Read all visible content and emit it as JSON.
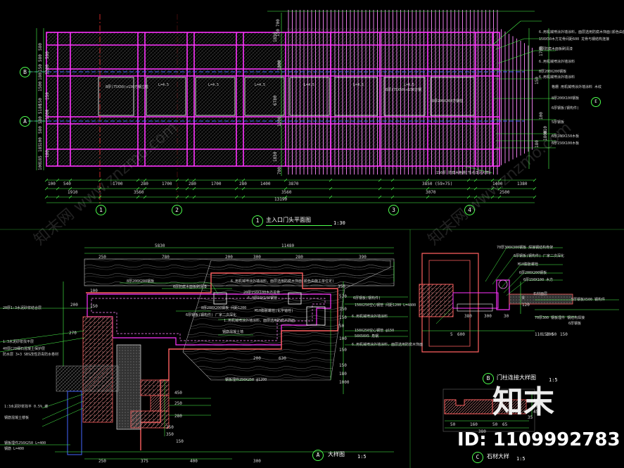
{
  "views": {
    "plan": {
      "marker": "1",
      "title": "主入口门头平面图",
      "scale": "1:30"
    },
    "detail_a": {
      "marker": "A",
      "title": "大样图",
      "scale": "1:5"
    },
    "detail_b": {
      "marker": "B",
      "title": "门柱连接大样图",
      "scale": "1:5"
    },
    "detail_c": {
      "marker": "C",
      "title": "石材大样",
      "scale": "1:5"
    }
  },
  "plan_axes": {
    "rows": [
      "B",
      "A"
    ],
    "cols": [
      "1",
      "2",
      "3",
      "4"
    ],
    "right_bubble": "E"
  },
  "plan_dims": {
    "left_vertical": [
      "580",
      "580",
      "150",
      "180",
      "1500",
      "150",
      "5180",
      "580",
      "580",
      "100",
      "185",
      "185",
      "100",
      "580",
      "1300",
      "150",
      "1500",
      "180"
    ],
    "top_horizontal": [
      "700",
      "150"
    ],
    "right_vertical": [
      "1850",
      "6780",
      "1850",
      "1800",
      "700",
      "1300",
      "1300",
      "1700",
      "1800",
      "150",
      "100",
      "810",
      "180"
    ],
    "bottom_row1": [
      "100",
      "540",
      "1700",
      "280",
      "1700",
      "280",
      "1700",
      "280",
      "1400",
      "3870",
      "3850 (59×75)",
      "1400",
      "1380"
    ],
    "bottom_row2": [
      "1910",
      "3560",
      "3560",
      "3070",
      "2500"
    ],
    "bottom_total": "13190"
  },
  "plan_notes": [
    "6.用机械喷涂外墙涂料，面层选用防腐木饰面(颜色由施工单位定)  盖板",
    "150X50木方龙骨间距600  龙骨与钢结构连接",
    "6厚防腐木面板刷清漆",
    "6.用机械喷涂外墙涂料",
    "8厚200X200钢板",
    "6.用机械喷涂外墙涂料",
    "格栅 用机械喷涂外墙涂料  木纹",
    "8厚200X100钢板",
    "6厚钢板(钢构件)",
    "5厚钢板",
    "6厚100X150木板",
    "6厚150X100木板"
  ],
  "plan_inner_labels": [
    "8厚(75X50)x150方钢立柱",
    "L=4.5",
    "L=4.5",
    "L=4.5",
    "L=4.5",
    "L=4.5",
    "L=4.5",
    "8厚(75X50)x150方钢",
    "8厚200X200方钢柱"
  ],
  "plan_bottom_note": "150厚 防腐木格栅(节点详见大样)",
  "detail_a_top_dims": [
    "250",
    "780",
    "200",
    "300",
    "280",
    "390"
  ],
  "detail_a_top_total1": "5830",
  "detail_a_top_total2": "11480",
  "detail_a_bottom_dims": [
    "250",
    "375",
    "400",
    "300"
  ],
  "detail_a_notes": [
    "6.用机械喷涂外墙涂料，面层选用防腐木饰面(颜色由施工单位定)",
    "8厚200X200钢板",
    "6厚防腐木面板刷清漆",
    "20厚150X100木方龙骨",
    "6.0厚50X100钢管",
    "6厚钢板(钢构件)",
    "8厚200X200钢板 间距1200",
    "150X250空心钢管 间距1200  L=4800",
    "M10膨胀螺栓(化学锚栓)",
    "6厚钢板(钢构件) 厂家二次深化",
    "6.用机械喷涂外墙涂料",
    "1.用机械喷涂外墙涂料，面层选用防腐木饰面",
    "150X250空心钢管 @150",
    "钢筋混凝土墙",
    "50X50X5 角钢",
    "6.用机械喷涂外墙涂料，面层选用防腐木饰面",
    "钢板埋件250X250 @1200",
    "20厚1:3水泥砂浆结合层",
    "1:3水泥砂浆找平层",
    "40厚C20细石混凝土保护层",
    "防水层 3+3 SBS改性沥青防水卷材",
    "1:3水泥砂浆找平 0.5% 坡",
    "钢筋混凝土楼板",
    "钢板埋件250X250 L=400",
    "钢筋 L=400"
  ],
  "detail_a_inner_dims": [
    "100",
    "150",
    "200",
    "270",
    "350",
    "520",
    "150",
    "150",
    "50",
    "100",
    "150",
    "200",
    "630",
    "150",
    "180",
    "1000",
    "450",
    "250",
    "280",
    "250",
    "350",
    "150"
  ],
  "detail_b_dims": [
    "5",
    "380",
    "300",
    "30",
    "600",
    "110",
    "150",
    "100",
    "50",
    "150",
    "8",
    "120"
  ],
  "detail_b_notes": [
    "70厚300X300钢板 焊接钢结构骨架",
    "6厚钢板(钢构件) 厂家二次深化",
    "M10膨胀螺栓",
    "6厚200X200钢板",
    "6厚150X100 木方",
    "石材面层",
    "5厚钢板X500 钢构件",
    "70厚300 钢板埋件 钢结构焊接",
    "6厚钢板"
  ],
  "detail_c_dims": [
    "50",
    "160",
    "50",
    "65",
    "380",
    "40",
    "40",
    "45",
    "35"
  ],
  "watermark": {
    "logo": "知末",
    "id_text": "ID: 1109992783",
    "diagonal": "知末网 www.znzmo.com"
  },
  "colors": {
    "background": "#000000",
    "beam": "#ff33ff",
    "axis_red": "#ff3333",
    "axis_blue": "#4466ff",
    "dimension_green": "#4cff4c",
    "text": "#ffffff",
    "hatch": "#cc7788",
    "highlight": "#ff6060"
  }
}
